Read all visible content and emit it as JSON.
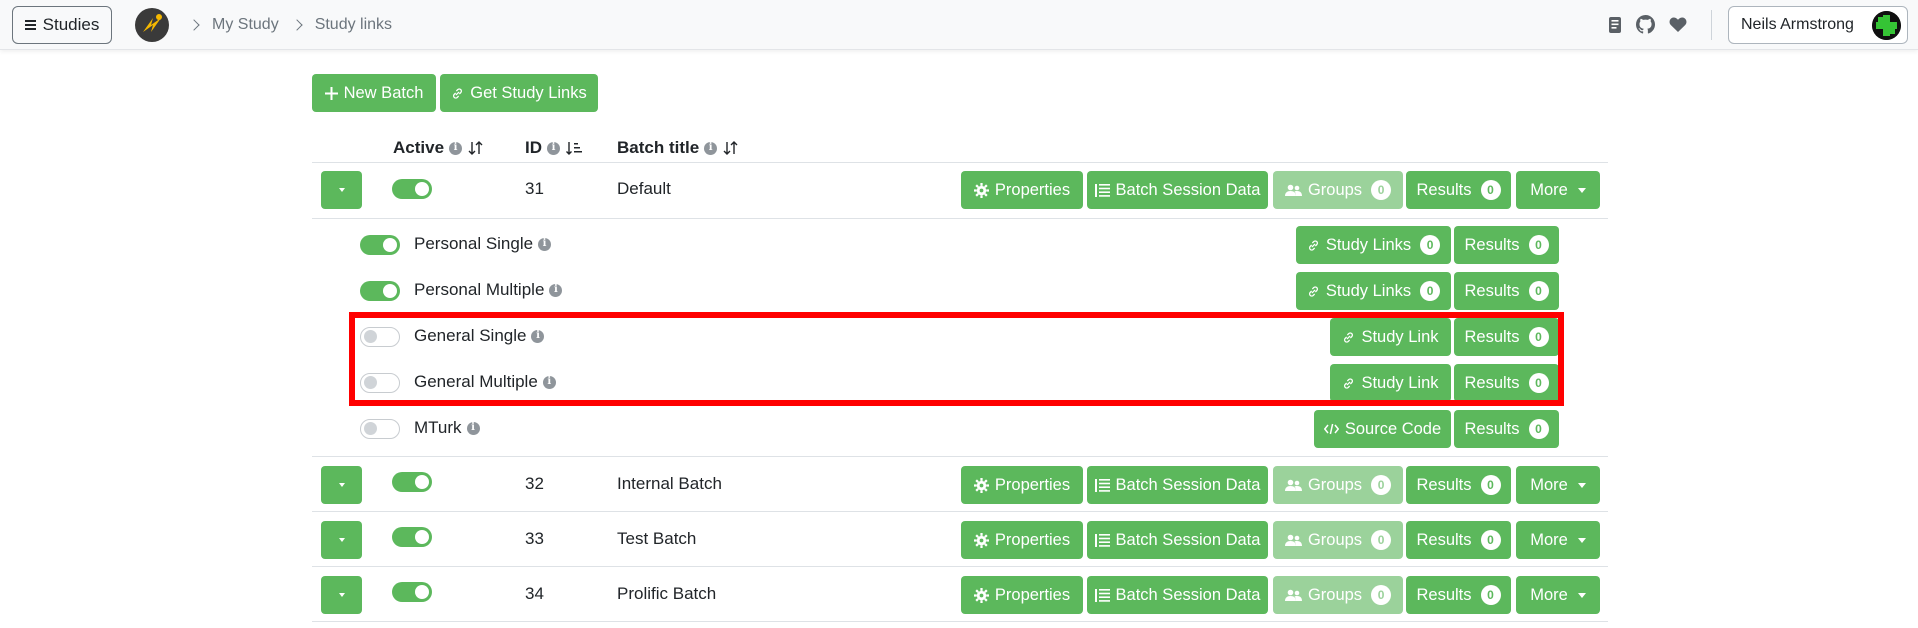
{
  "topbar": {
    "studies_label": "Studies",
    "breadcrumbs": [
      "My Study",
      "Study links"
    ],
    "user_name": "Neils Armstrong"
  },
  "toolbar": {
    "new_batch_label": "New Batch",
    "get_links_label": "Get Study Links"
  },
  "table": {
    "headers": {
      "active": "Active",
      "id": "ID",
      "title": "Batch title"
    },
    "batches": [
      {
        "id": "31",
        "title": "Default",
        "active": true
      },
      {
        "id": "32",
        "title": "Internal Batch",
        "active": true
      },
      {
        "id": "33",
        "title": "Test Batch",
        "active": true
      },
      {
        "id": "34",
        "title": "Prolific Batch",
        "active": true
      }
    ],
    "batch_buttons": {
      "properties": "Properties",
      "session_data": "Batch Session Data",
      "groups": "Groups",
      "groups_count": "0",
      "results": "Results",
      "results_count": "0",
      "more": "More"
    },
    "study_link_types": [
      {
        "name": "Personal Single",
        "active": true,
        "action": "Study Links",
        "action_count": "0",
        "results": "Results",
        "results_count": "0"
      },
      {
        "name": "Personal Multiple",
        "active": true,
        "action": "Study Links",
        "action_count": "0",
        "results": "Results",
        "results_count": "0"
      },
      {
        "name": "General Single",
        "active": false,
        "action": "Study Link",
        "results": "Results",
        "results_count": "0"
      },
      {
        "name": "General Multiple",
        "active": false,
        "action": "Study Link",
        "results": "Results",
        "results_count": "0"
      },
      {
        "name": "MTurk",
        "active": false,
        "action": "Source Code",
        "results": "Results",
        "results_count": "0"
      }
    ]
  },
  "colors": {
    "primary_green": "#5cb85c",
    "faded_green": "#9bd29b",
    "highlight_red": "#ff0000"
  }
}
